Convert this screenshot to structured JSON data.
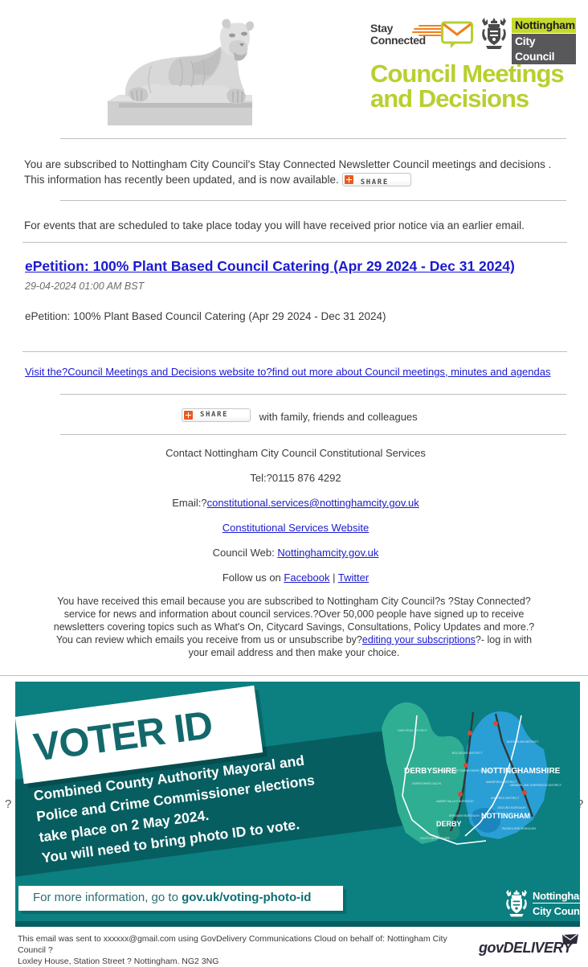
{
  "header": {
    "lion_alt": "Nottingham Council House stone lion statue",
    "stay_connected_line1": "Stay",
    "stay_connected_line2": "Connected",
    "council_line1": "Nottingham",
    "council_line2": "City Council",
    "banner_title_line1": "Council Meetings",
    "banner_title_line2": "and Decisions",
    "brand_green": "#b9cf2f",
    "brand_grey": "#58585a",
    "brand_orange": "#f08020"
  },
  "intro": {
    "line1": "You are subscribed to Nottingham City Council's Stay Connected Newsletter Council meetings and decisions .",
    "line2": "This information has recently been updated, and is now available.",
    "share_label": "SHARE"
  },
  "events_notice": "For events that are scheduled to take place today you will have received prior notice via an earlier email.",
  "item": {
    "title": "ePetition: 100% Plant Based Council Catering (Apr 29 2024 - Dec 31 2024)",
    "date": "29-04-2024 01:00 AM BST",
    "body": "ePetition: 100% Plant Based Council Catering (Apr 29 2024 - Dec 31 2024)"
  },
  "visit_link": "Visit the?Council Meetings and Decisions website to?find out more about Council meetings, minutes and agendas",
  "share_row": {
    "share_label": "SHARE",
    "suffix": "with family, friends and colleagues"
  },
  "contact": {
    "heading": "Contact Nottingham City Council Constitutional Services",
    "tel": "Tel:?0115 876 4292",
    "email_prefix": "Email:?",
    "email": "constitutional.services@nottinghamcity.gov.uk",
    "services_website": "Constitutional Services Website",
    "council_web_prefix": "Council Web: ",
    "council_web": "Nottinghamcity.gov.uk",
    "follow_prefix": "Follow us on ",
    "facebook": "Facebook",
    "separator": " | ",
    "twitter": "Twitter"
  },
  "legal": {
    "part1": "You have received this email because you are subscribed to Nottingham City Council?s ?Stay Connected? service for news and information about council services.?Over 50,000 people have signed up to receive newsletters covering topics such as What's On, Citycard Savings, Consultations, Policy Updates and more.?You can review which emails you receive from us or unsubscribe by?",
    "link": "editing your subscriptions",
    "part2": "?- log in with your email address and then make your choice."
  },
  "voter_banner": {
    "title": "VOTER ID",
    "line1": "Combined County Authority Mayoral and",
    "line2": "Police and Crime Commissioner elections",
    "line3": "take place on 2 May 2024.",
    "line4": "You will need to bring photo ID to vote.",
    "info_prefix": "For more information, go to ",
    "info_url": "gov.uk/voting-photo-id",
    "logo_line1": "Nottingham",
    "logo_line2": "City Council",
    "teal": "#0c7f80",
    "teal_dark": "#075e60",
    "map_labels": {
      "derbyshire": "DERBYSHIRE",
      "nottinghamshire": "NOTTINGHAMSHIRE",
      "derby": "DERBY",
      "nottingham": "NOTTINGHAM"
    },
    "missing_image_marker": "?"
  },
  "footer": {
    "line1": "This email was sent to xxxxxx@gmail.com using GovDelivery Communications Cloud on behalf of: Nottingham City Council ?",
    "line2": "Loxley House, Station Street ? Nottingham. NG2 3NG",
    "brand": "govDELIVERY"
  }
}
